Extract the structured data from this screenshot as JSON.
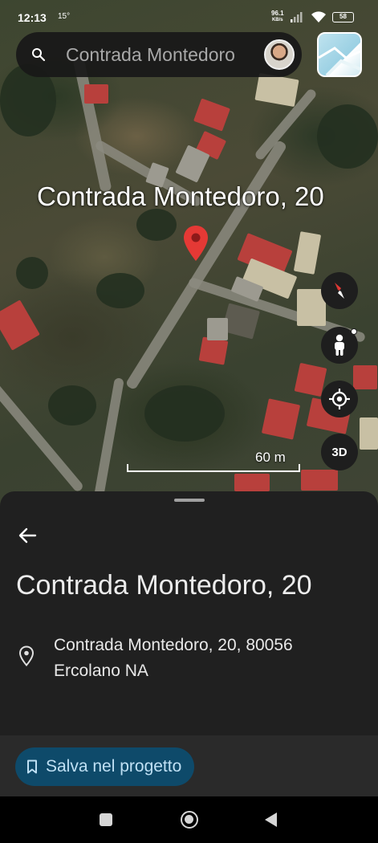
{
  "status_bar": {
    "time": "12:13",
    "temperature": "15°",
    "net_speed_value": "96.1",
    "net_speed_unit": "KB/s",
    "battery": "58"
  },
  "search": {
    "text": "Contrada Montedoro"
  },
  "map": {
    "place_label": "Contrada Montedoro, 20",
    "threed_label": "3D",
    "scale_label": "60 m",
    "pin_color": "#e53935"
  },
  "sheet": {
    "title": "Contrada Montedoro, 20",
    "address_line1": "Contrada Montedoro, 20, 80056",
    "address_line2": "Ercolano NA",
    "save_label": "Salva nel progetto",
    "save_color": "#0e4a6a"
  },
  "icons": [
    "search-icon",
    "avatar",
    "layers-icon",
    "map-pin-icon",
    "compass-icon",
    "pegman-icon",
    "my-location-icon",
    "back-arrow-icon",
    "location-pin-outline-icon",
    "bookmark-icon",
    "nav-recent-icon",
    "nav-home-icon",
    "nav-back-icon"
  ]
}
